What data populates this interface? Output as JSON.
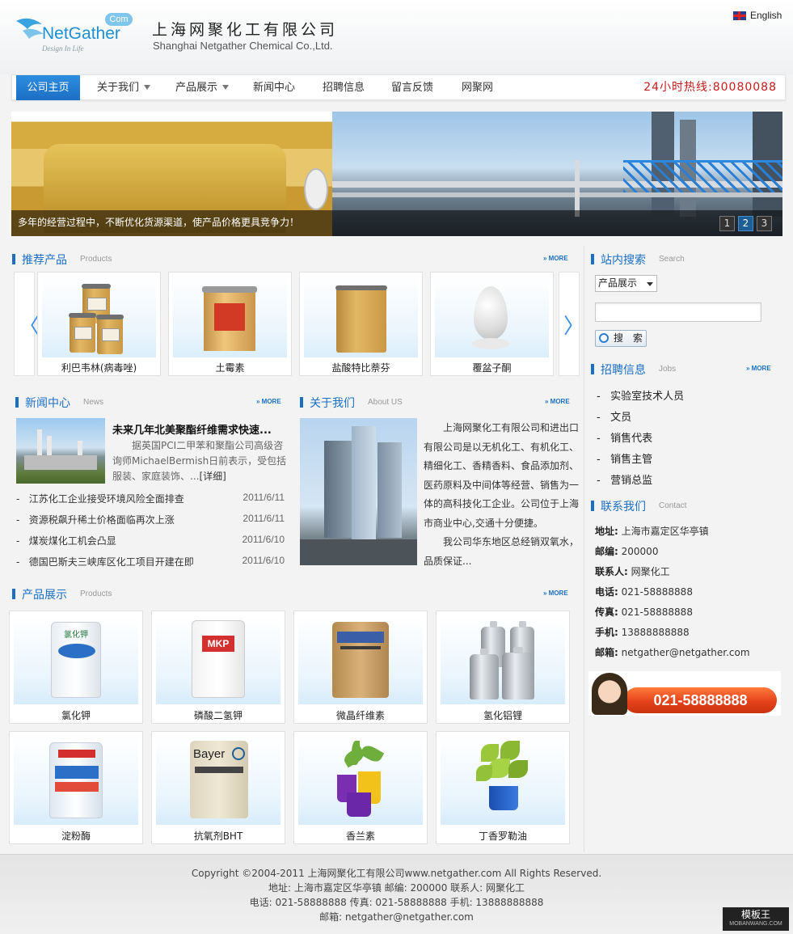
{
  "header": {
    "logo_word": "NetGather",
    "logo_com": "Com",
    "logo_tagline": "Design In Life",
    "company_cn": "上海网聚化工有限公司",
    "company_en": "Shanghai Netgather Chemical Co.,Ltd.",
    "language_link": "English"
  },
  "nav": {
    "items": [
      {
        "label": "公司主页",
        "active": true
      },
      {
        "label": "关于我们",
        "dropdown": true
      },
      {
        "label": "产品展示",
        "dropdown": true
      },
      {
        "label": "新闻中心"
      },
      {
        "label": "招聘信息"
      },
      {
        "label": "留言反馈"
      },
      {
        "label": "网聚网"
      }
    ],
    "hotline": "24小时热线:80080088"
  },
  "banner": {
    "caption": "多年的经营过程中，不断优化货源渠道，使产品价格更具竞争力！",
    "pages": [
      "1",
      "2",
      "3"
    ],
    "active_page": "2"
  },
  "recommended": {
    "title": "推荐产品",
    "title_en": "Products",
    "more": "MORE",
    "prev_arrow": "〈",
    "next_arrow": "〉",
    "items": [
      "利巴韦林(病毒唑)",
      "土霉素",
      "盐酸特比萘芬",
      "覆盆子酮"
    ]
  },
  "news": {
    "title": "新闻中心",
    "title_en": "News",
    "more": "MORE",
    "headline": "未来几年北美聚酯纤维需求快速...",
    "summary": "据英国PCI二甲苯和聚酯公司高级咨询师MichaelBermish日前表示，受包括服装、家庭装饰、...",
    "detail_link": "[详细]",
    "items": [
      {
        "title": "江苏化工企业接受环境风险全面排查",
        "date": "2011/6/11"
      },
      {
        "title": "资源税飙升稀土价格面临再次上涨",
        "date": "2011/6/11"
      },
      {
        "title": "煤炭煤化工机会凸显",
        "date": "2011/6/10"
      },
      {
        "title": "德国巴斯夫三峡库区化工项目开建在即",
        "date": "2011/6/10"
      }
    ]
  },
  "about": {
    "title": "关于我们",
    "title_en": "About US",
    "more": "MORE",
    "p1": "上海网聚化工有限公司和进出口有限公司是以无机化工、有机化工、精细化工、香精香料、食品添加剂、医药原料及中间体等经营、销售为一体的高科技化工企业。公司位于上海市商业中心,交通十分便捷。",
    "p2": "我公司华东地区总经销双氧水，品质保证..."
  },
  "products": {
    "title": "产品展示",
    "title_en": "Products",
    "more": "MORE",
    "items": [
      "氯化钾",
      "磷酸二氢钾",
      "微晶纤维素",
      "氢化铝锂",
      "淀粉酶",
      "抗氧剂BHT",
      "香兰素",
      "丁香罗勒油"
    ],
    "bag_texts": [
      "氯化钾",
      "MKP",
      "",
      "",
      "",
      "Bayer",
      "",
      ""
    ]
  },
  "search": {
    "title": "站内搜索",
    "title_en": "Search",
    "category": "产品展示",
    "input_value": "",
    "button": "搜 索"
  },
  "jobs": {
    "title": "招聘信息",
    "title_en": "Jobs",
    "more": "MORE",
    "items": [
      "实验室技术人员",
      "文员",
      "销售代表",
      "销售主管",
      "营销总监"
    ]
  },
  "contact": {
    "title": "联系我们",
    "title_en": "Contact",
    "rows": [
      {
        "label": "地址:",
        "value": "上海市嘉定区华亭镇"
      },
      {
        "label": "邮编:",
        "value": "200000"
      },
      {
        "label": "联系人:",
        "value": "网聚化工"
      },
      {
        "label": "电话:",
        "value": "021-58888888"
      },
      {
        "label": "传真:",
        "value": "021-58888888"
      },
      {
        "label": "手机:",
        "value": "13888888888"
      },
      {
        "label": "邮箱:",
        "value": "netgather@netgather.com"
      }
    ],
    "hotline_banner": "021-58888888"
  },
  "footer": {
    "line1": "Copyright ©2004-2011 上海网聚化工有限公司www.netgather.com All Rights Reserved.",
    "line2": "地址: 上海市嘉定区华亭镇   邮编: 200000   联系人: 网聚化工",
    "line3": "电话: 021-58888888   传真: 021-58888888   手机: 13888888888",
    "line4": "邮箱: netgather@netgather.com",
    "watermark": "模板王",
    "watermark_sub": "MOBANWANG.COM"
  },
  "colors": {
    "accent": "#1b6fc4",
    "hotline_red": "#c71a1a",
    "page_bg": "#f3f3f3"
  }
}
